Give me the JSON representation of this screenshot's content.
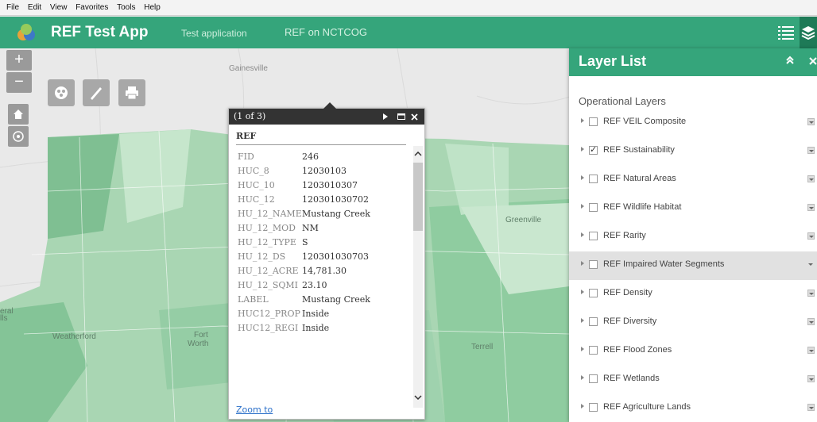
{
  "menubar": {
    "items": [
      "File",
      "Edit",
      "View",
      "Favorites",
      "Tools",
      "Help"
    ]
  },
  "app": {
    "title": "REF Test App",
    "subtitle": "Test application",
    "link": "REF on NCTCOG",
    "accent": "#35a57b"
  },
  "map": {
    "labels": {
      "gainesville": "Gainesville",
      "greenville": "Greenville",
      "weatherford": "Weatherford",
      "fort": "Fort",
      "worth": "Worth",
      "terrell": "Terrell",
      "cut_left_1": "eral",
      "cut_left_2": "lls"
    },
    "controls": {
      "zoom_in": "+",
      "zoom_out": "−",
      "home_icon": "home-icon",
      "locate_icon": "locate-icon"
    },
    "tools": [
      "basemap-gallery-icon",
      "measure-icon",
      "print-icon"
    ]
  },
  "popup": {
    "counter": "(1 of 3)",
    "title": "REF",
    "zoom_to": "Zoom to",
    "attributes": [
      {
        "key": "FID",
        "value": "246"
      },
      {
        "key": "HUC_8",
        "value": "12030103"
      },
      {
        "key": "HUC_10",
        "value": "1203010307"
      },
      {
        "key": "HUC_12",
        "value": "120301030702"
      },
      {
        "key": "HU_12_NAME",
        "value": "Mustang Creek"
      },
      {
        "key": "HU_12_MOD",
        "value": "NM"
      },
      {
        "key": "HU_12_TYPE",
        "value": "S"
      },
      {
        "key": "HU_12_DS",
        "value": "120301030703"
      },
      {
        "key": "HU_12_ACRE",
        "value": "14,781.30"
      },
      {
        "key": "HU_12_SQMI",
        "value": "23.10"
      },
      {
        "key": "LABEL",
        "value": "Mustang Creek"
      },
      {
        "key": "HUC12_PROP",
        "value": "Inside"
      },
      {
        "key": "HUC12_REGI",
        "value": "Inside"
      }
    ]
  },
  "layer_panel": {
    "title": "Layer List",
    "section": "Operational Layers",
    "layers": [
      {
        "label": "REF VEIL Composite",
        "checked": false
      },
      {
        "label": "REF Sustainability",
        "checked": true
      },
      {
        "label": "REF Natural Areas",
        "checked": false
      },
      {
        "label": "REF Wildlife Habitat",
        "checked": false
      },
      {
        "label": "REF Rarity",
        "checked": false
      },
      {
        "label": "REF Impaired Water Segments",
        "checked": false,
        "highlighted": true
      },
      {
        "label": "REF Density",
        "checked": false
      },
      {
        "label": "REF Diversity",
        "checked": false
      },
      {
        "label": "REF Flood Zones",
        "checked": false
      },
      {
        "label": "REF Wetlands",
        "checked": false
      },
      {
        "label": "REF Agriculture Lands",
        "checked": false
      }
    ]
  }
}
